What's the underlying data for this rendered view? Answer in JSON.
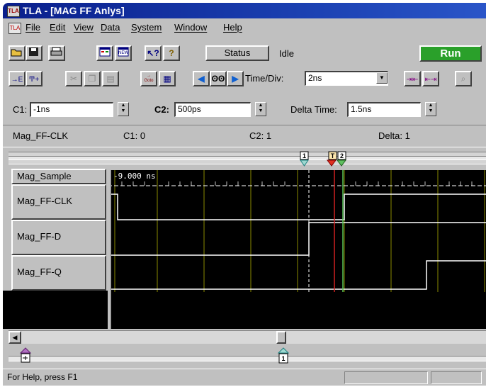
{
  "window": {
    "title": "TLA - [MAG FF Anlys]"
  },
  "menu": [
    "File",
    "Edit",
    "View",
    "Data",
    "System",
    "Window",
    "Help"
  ],
  "toolbar1": {
    "status_button": "Status",
    "status_value": "Idle",
    "run_button": "Run",
    "new_icon_text": "NEW"
  },
  "toolbar2": {
    "time_div_label": "Time/Div:",
    "time_div_value": "2ns"
  },
  "cursors": {
    "c1_label": "C1:",
    "c1_value": "-1ns",
    "c2_label": "C2:",
    "c2_value": "500ps",
    "delta_label": "Delta Time:",
    "delta_value": "1.5ns"
  },
  "readout": {
    "signal": "Mag_FF-CLK",
    "c1": "C1: 0",
    "c2": "C2: 1",
    "delta": "Delta: 1"
  },
  "markers": {
    "c1": "1",
    "c2": "2",
    "trigger": "T"
  },
  "channels": [
    {
      "name": "Mag_Sample"
    },
    {
      "name": "Mag_FF-CLK"
    },
    {
      "name": "Mag_FF-D"
    },
    {
      "name": "Mag_FF-Q"
    }
  ],
  "waveform": {
    "timestamp": "-9.000 ns"
  },
  "overview": {
    "marker_label": "1"
  },
  "statusbar": {
    "help_text": "For Help, press F1"
  },
  "colors": {
    "run_green": "#2aa02a",
    "grid": "#8a8a00",
    "trace": "#ffffff",
    "trigger_line": "#d02020",
    "cursor2_line": "#58c458"
  }
}
